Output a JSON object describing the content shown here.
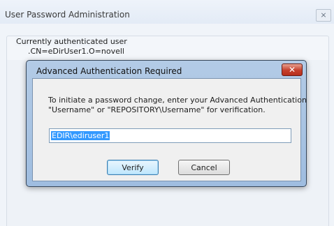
{
  "background_window": {
    "title": "User Password Administration",
    "close_glyph": "⨯",
    "group_label": "Currently authenticated user",
    "group_value": ".CN=eDirUser1.O=novell"
  },
  "dialog": {
    "title": "Advanced Authentication Required",
    "close_glyph": "✕",
    "prompt_line1": "To initiate a password change, enter your Advanced Authentication",
    "prompt_line2": "\"Username\" or \"REPOSITORY\\Username\" for verification.",
    "input_value": "EDIR\\ediruser1",
    "verify_label": "Verify",
    "cancel_label": "Cancel"
  },
  "colors": {
    "dialog_frame": "#a9c4e4",
    "close_red": "#c6402c",
    "selection": "#3399ff"
  }
}
